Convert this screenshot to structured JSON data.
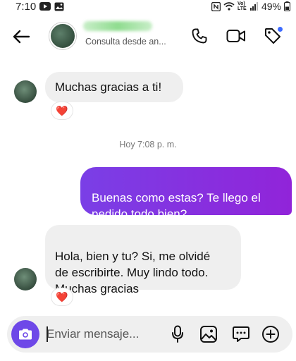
{
  "status_bar": {
    "time": "7:10",
    "battery": "49%",
    "network_label": "Vo) LTE"
  },
  "header": {
    "back_icon": "arrow-left-icon",
    "contact_subtitle": "Consulta desde an...",
    "icons": [
      "phone-icon",
      "video-camera-icon",
      "tag-icon"
    ]
  },
  "messages": [
    {
      "direction": "incoming",
      "text": "Muchas gracias a ti!",
      "reaction": "❤️"
    },
    {
      "direction": "outgoing",
      "text": "Buenas como estas? Te llego el\npedido todo bien?"
    },
    {
      "direction": "incoming",
      "text": "Hola, bien y tu? Si, me olvidé\nde escribirte. Muy lindo todo.\nMuchas gracias",
      "reaction": "❤️"
    }
  ],
  "timestamp": "Hoy 7:08 p. m.",
  "composer": {
    "placeholder": "Enviar mensaje...",
    "icons": [
      "camera-icon",
      "microphone-icon",
      "gallery-icon",
      "sticker-icon",
      "plus-icon"
    ]
  },
  "colors": {
    "outgoing_bubble": "#8a2be2",
    "incoming_bubble": "#efefef",
    "camera_button": "#6e48e8",
    "notification_dot": "#3d6bff"
  }
}
